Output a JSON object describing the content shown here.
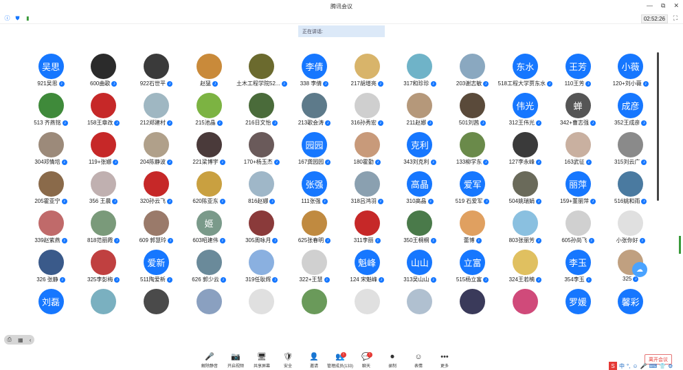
{
  "window": {
    "title": "腾讯会议",
    "timer": "02:52:26"
  },
  "speaking_label": "正在讲话:",
  "participants": [
    {
      "name": "921吴思",
      "avatar_text": "吴思",
      "color": "#1677ff"
    },
    {
      "name": "600曲歌",
      "avatar_text": "",
      "color": "#2b2b2b"
    },
    {
      "name": "922石世平",
      "avatar_text": "",
      "color": "#3a3a3a"
    },
    {
      "name": "赵猛",
      "avatar_text": "",
      "color": "#c98a3a"
    },
    {
      "name": "土木工程学院52...",
      "avatar_text": "",
      "color": "#6b6a2e"
    },
    {
      "name": "338 李倩",
      "avatar_text": "李倩",
      "color": "#1677ff"
    },
    {
      "name": "217胡增亮",
      "avatar_text": "",
      "color": "#d8b46a"
    },
    {
      "name": "317和珍珍",
      "avatar_text": "",
      "color": "#6fb3c8"
    },
    {
      "name": "203谢志敏",
      "avatar_text": "",
      "color": "#8aa8c0"
    },
    {
      "name": "518工程大学贾东水",
      "avatar_text": "东水",
      "color": "#1677ff"
    },
    {
      "name": "110王芳",
      "avatar_text": "王芳",
      "color": "#1677ff"
    },
    {
      "name": "120+刘小薇",
      "avatar_text": "小薇",
      "color": "#1677ff"
    },
    {
      "name": "513 齐燕铭",
      "avatar_text": "",
      "color": "#3f8a3a"
    },
    {
      "name": "158王章改",
      "avatar_text": "",
      "color": "#c62828"
    },
    {
      "name": "212郑建村",
      "avatar_text": "",
      "color": "#9fb7c2"
    },
    {
      "name": "215池晶",
      "avatar_text": "",
      "color": "#7cb342"
    },
    {
      "name": "216日文怡",
      "avatar_text": "",
      "color": "#4a6b3a"
    },
    {
      "name": "213歌会涛",
      "avatar_text": "",
      "color": "#5d7a8a"
    },
    {
      "name": "316孙秀宏",
      "avatar_text": "",
      "color": "#cfcfcf"
    },
    {
      "name": "211赵娜",
      "avatar_text": "",
      "color": "#b5987a"
    },
    {
      "name": "501刘茜",
      "avatar_text": "",
      "color": "#5a4a3a"
    },
    {
      "name": "312王伟光",
      "avatar_text": "伟光",
      "color": "#1677ff"
    },
    {
      "name": "342+曹志强",
      "avatar_text": "蝉",
      "color": "#555555"
    },
    {
      "name": "352王成彦",
      "avatar_text": "成彦",
      "color": "#1677ff"
    },
    {
      "name": "304邓情培",
      "avatar_text": "",
      "color": "#9c8a7a"
    },
    {
      "name": "119+张娜",
      "avatar_text": "",
      "color": "#c62828"
    },
    {
      "name": "204陈静波",
      "avatar_text": "",
      "color": "#b0a08a"
    },
    {
      "name": "221梁博宇",
      "avatar_text": "",
      "color": "#4a3a3a"
    },
    {
      "name": "170+杨玉杰",
      "avatar_text": "",
      "color": "#6a5a5a"
    },
    {
      "name": "167龚园园",
      "avatar_text": "园园",
      "color": "#1677ff"
    },
    {
      "name": "180霍勤",
      "avatar_text": "",
      "color": "#c89a7a"
    },
    {
      "name": "343刘克利",
      "avatar_text": "克利",
      "color": "#1677ff"
    },
    {
      "name": "133柳学东",
      "avatar_text": "",
      "color": "#6a8a4a"
    },
    {
      "name": "127李永峰",
      "avatar_text": "",
      "color": "#3a3a3a"
    },
    {
      "name": "163武征",
      "avatar_text": "",
      "color": "#c9b0a0"
    },
    {
      "name": "315刘云广",
      "avatar_text": "",
      "color": "#8a8a8a"
    },
    {
      "name": "205霍亚宁",
      "avatar_text": "",
      "color": "#8a6a4a"
    },
    {
      "name": "356 王晨",
      "avatar_text": "",
      "color": "#c0b0b0"
    },
    {
      "name": "320孙云飞",
      "avatar_text": "",
      "color": "#c62828"
    },
    {
      "name": "620陈亚东",
      "avatar_text": "",
      "color": "#c9a040"
    },
    {
      "name": "816赵娜",
      "avatar_text": "",
      "color": "#9fb7c8"
    },
    {
      "name": "111张强",
      "avatar_text": "张强",
      "color": "#1677ff"
    },
    {
      "name": "318吕鸿羽",
      "avatar_text": "",
      "color": "#8aa0b0"
    },
    {
      "name": "310高晶",
      "avatar_text": "高晶",
      "color": "#1677ff"
    },
    {
      "name": "519 石爱军",
      "avatar_text": "爱军",
      "color": "#1677ff"
    },
    {
      "name": "504姚瑞娟",
      "avatar_text": "",
      "color": "#6a6a5a"
    },
    {
      "name": "159+董丽萍",
      "avatar_text": "丽萍",
      "color": "#1677ff"
    },
    {
      "name": "516姚和雨",
      "avatar_text": "",
      "color": "#4a7aa0"
    },
    {
      "name": "339赵紫燕",
      "avatar_text": "",
      "color": "#c06a6a"
    },
    {
      "name": "818范丽霞",
      "avatar_text": "",
      "color": "#7a9a7a"
    },
    {
      "name": "609 郭慧玲",
      "avatar_text": "",
      "color": "#9a7a6a"
    },
    {
      "name": "603昭建伟",
      "avatar_text": "姬",
      "color": "#7a9a8a"
    },
    {
      "name": "305周咏月",
      "avatar_text": "",
      "color": "#8a3a3a"
    },
    {
      "name": "625张春明",
      "avatar_text": "",
      "color": "#c08a40"
    },
    {
      "name": "311李丽",
      "avatar_text": "",
      "color": "#c62828"
    },
    {
      "name": "350王桐桐",
      "avatar_text": "",
      "color": "#4a7a4a"
    },
    {
      "name": "蕾博",
      "avatar_text": "",
      "color": "#e0a060"
    },
    {
      "name": "803张丽芳",
      "avatar_text": "",
      "color": "#8ac0e0"
    },
    {
      "name": "605孙尚飞",
      "avatar_text": "",
      "color": "#d0d0d0"
    },
    {
      "name": "小张你好",
      "avatar_text": "",
      "color": "#e0e0e0"
    },
    {
      "name": "326 张静",
      "avatar_text": "",
      "color": "#3a5a8a"
    },
    {
      "name": "325李彭梅",
      "avatar_text": "",
      "color": "#c04040"
    },
    {
      "name": "511陶爱新",
      "avatar_text": "爱新",
      "color": "#1677ff"
    },
    {
      "name": "626 郭少云",
      "avatar_text": "",
      "color": "#6a8a9a"
    },
    {
      "name": "319任耿辉",
      "avatar_text": "",
      "color": "#8ab0e0"
    },
    {
      "name": "322+王慧",
      "avatar_text": "",
      "color": "#d0d0d0"
    },
    {
      "name": "124 宋魁峰",
      "avatar_text": "魁峰",
      "color": "#1677ff"
    },
    {
      "name": "313吴山山",
      "avatar_text": "山山",
      "color": "#1677ff"
    },
    {
      "name": "515杨立富",
      "avatar_text": "立富",
      "color": "#1677ff"
    },
    {
      "name": "324王若楠",
      "avatar_text": "",
      "color": "#e0c060"
    },
    {
      "name": "354李玉",
      "avatar_text": "李玉",
      "color": "#1677ff"
    },
    {
      "name": "325",
      "avatar_text": "",
      "color": "#c0a080"
    },
    {
      "name": "",
      "avatar_text": "刘磊",
      "color": "#1677ff"
    },
    {
      "name": "",
      "avatar_text": "",
      "color": "#7ab0c0"
    },
    {
      "name": "",
      "avatar_text": "",
      "color": "#4a4a4a"
    },
    {
      "name": "",
      "avatar_text": "",
      "color": "#8aa0c0"
    },
    {
      "name": "",
      "avatar_text": "",
      "color": "#e0e0e0"
    },
    {
      "name": "",
      "avatar_text": "",
      "color": "#6a9a5a"
    },
    {
      "name": "",
      "avatar_text": "",
      "color": "#e0e0e0"
    },
    {
      "name": "",
      "avatar_text": "",
      "color": "#b0c0d0"
    },
    {
      "name": "",
      "avatar_text": "",
      "color": "#3a3a5a"
    },
    {
      "name": "",
      "avatar_text": "",
      "color": "#d04a7a"
    },
    {
      "name": "",
      "avatar_text": "罗媛",
      "color": "#1677ff"
    },
    {
      "name": "",
      "avatar_text": "馨彩",
      "color": "#1677ff"
    }
  ],
  "toolbar": [
    {
      "label": "解除静音",
      "icon": "🎤"
    },
    {
      "label": "开启视频",
      "icon": "📷"
    },
    {
      "label": "共享屏幕",
      "icon": "🖥"
    },
    {
      "label": "安全",
      "icon": "🛡"
    },
    {
      "label": "邀请",
      "icon": "👤"
    },
    {
      "label": "管理成员(133)",
      "icon": "👥"
    },
    {
      "label": "聊天",
      "icon": "💬"
    },
    {
      "label": "录制",
      "icon": "⏺"
    },
    {
      "label": "表情",
      "icon": "☺"
    },
    {
      "label": "更多",
      "icon": "•••"
    }
  ],
  "leave_label": "离开会议",
  "ime": [
    "中",
    "°,",
    "☺",
    "🎤",
    "⌨",
    "👕",
    "⚙"
  ]
}
